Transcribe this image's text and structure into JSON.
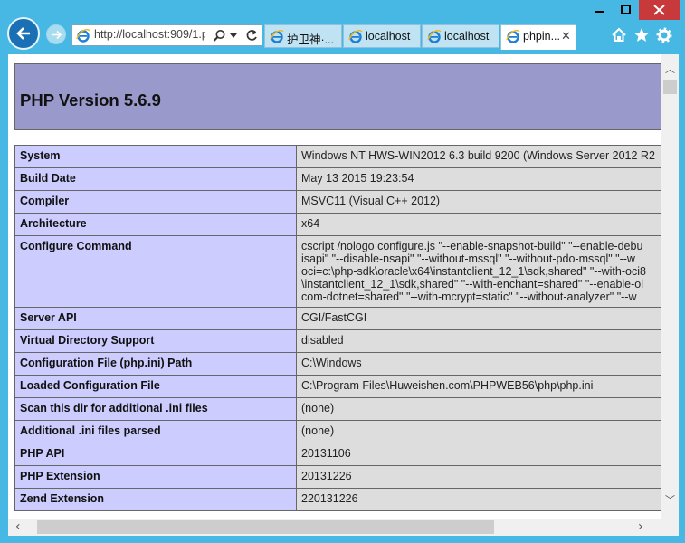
{
  "browser": {
    "address": "http://localhost:909/1.p",
    "tabs": [
      {
        "label": "护卫神·..."
      },
      {
        "label": "localhost"
      },
      {
        "label": "localhost"
      },
      {
        "label": "phpin..."
      }
    ],
    "close_tab_glyph": "✕",
    "icons": [
      "back-arrow-icon",
      "forward-arrow-icon",
      "ie-logo-icon",
      "search-icon",
      "dropdown-icon",
      "refresh-icon",
      "home-icon",
      "star-icon",
      "gear-icon",
      "close-icon"
    ]
  },
  "page": {
    "title": "PHP Version 5.6.9",
    "rows": [
      {
        "key": "System",
        "lines": [
          "Windows NT HWS-WIN2012 6.3 build 9200 (Windows Server 2012 R2"
        ]
      },
      {
        "key": "Build Date",
        "lines": [
          "May 13 2015 19:23:54"
        ]
      },
      {
        "key": "Compiler",
        "lines": [
          "MSVC11 (Visual C++ 2012)"
        ]
      },
      {
        "key": "Architecture",
        "lines": [
          "x64"
        ]
      },
      {
        "key": "Configure Command",
        "lines": [
          "cscript /nologo configure.js \"--enable-snapshot-build\" \"--enable-debu",
          "isapi\" \"--disable-nsapi\" \"--without-mssql\" \"--without-pdo-mssql\" \"--w",
          "oci=c:\\php-sdk\\oracle\\x64\\instantclient_12_1\\sdk,shared\" \"--with-oci8",
          "\\instantclient_12_1\\sdk,shared\" \"--with-enchant=shared\" \"--enable-ol",
          "com-dotnet=shared\" \"--with-mcrypt=static\" \"--without-analyzer\" \"--w"
        ]
      },
      {
        "key": "Server API",
        "lines": [
          "CGI/FastCGI"
        ]
      },
      {
        "key": "Virtual Directory Support",
        "lines": [
          "disabled"
        ]
      },
      {
        "key": "Configuration File (php.ini) Path",
        "lines": [
          "C:\\Windows"
        ]
      },
      {
        "key": "Loaded Configuration File",
        "lines": [
          "C:\\Program Files\\Huweishen.com\\PHPWEB56\\php\\php.ini"
        ]
      },
      {
        "key": "Scan this dir for additional .ini files",
        "lines": [
          "(none)"
        ]
      },
      {
        "key": "Additional .ini files parsed",
        "lines": [
          "(none)"
        ]
      },
      {
        "key": "PHP API",
        "lines": [
          "20131106"
        ]
      },
      {
        "key": "PHP Extension",
        "lines": [
          "20131226"
        ]
      },
      {
        "key": "Zend Extension",
        "lines": [
          "220131226"
        ]
      }
    ]
  },
  "colors": {
    "frame": "#47b8e3",
    "header_bg": "#9999cc",
    "key_cell": "#ccccff",
    "value_cell": "#dddddd",
    "close_button": "#c7393a"
  }
}
